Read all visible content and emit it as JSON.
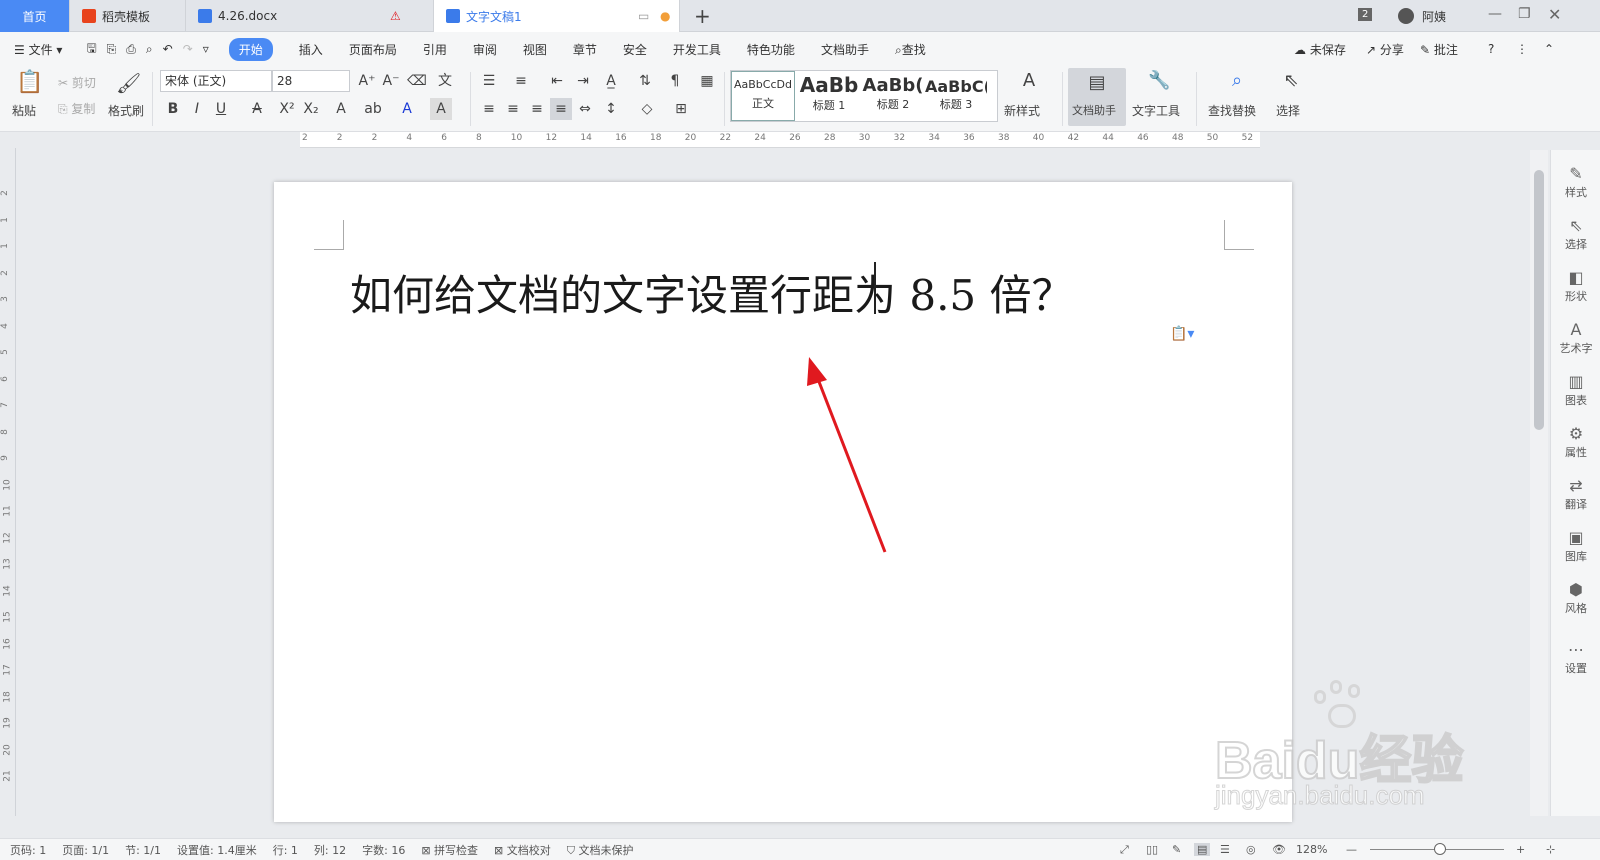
{
  "tabs": [
    {
      "label": "首页"
    },
    {
      "label": "稻壳模板"
    },
    {
      "label": "4.26.docx"
    },
    {
      "label": "文字文稿1"
    }
  ],
  "window": {
    "badge": "2",
    "user": "阿姨"
  },
  "menu": {
    "file": "文件",
    "items": [
      "开始",
      "插入",
      "页面布局",
      "引用",
      "审阅",
      "视图",
      "章节",
      "安全",
      "开发工具",
      "特色功能",
      "文档助手"
    ],
    "search": "查找",
    "right": [
      "未保存",
      "分享",
      "批注"
    ]
  },
  "ribbon": {
    "paste": "粘贴",
    "cut": "剪切",
    "copy": "复制",
    "format_painter": "格式刷",
    "font": "宋体 (正文)",
    "size": "28",
    "styles": [
      {
        "preview": "AaBbCcDd",
        "label": "正文"
      },
      {
        "preview": "AaBb",
        "label": "标题 1"
      },
      {
        "preview": "AaBb(",
        "label": "标题 2"
      },
      {
        "preview": "AaBbC(",
        "label": "标题 3"
      }
    ],
    "new_style": "新样式",
    "doc_assistant": "文档助手",
    "text_tools": "文字工具",
    "find_replace": "查找替换",
    "select": "选择"
  },
  "ruler": [
    "2",
    "2",
    "2",
    "4",
    "6",
    "8",
    "10",
    "12",
    "14",
    "16",
    "18",
    "20",
    "22",
    "24",
    "26",
    "28",
    "30",
    "32",
    "34",
    "36",
    "38",
    "40",
    "42",
    "44",
    "46",
    "48",
    "50",
    "52"
  ],
  "vruler": [
    "2",
    "1",
    "1",
    "2",
    "3",
    "4",
    "5",
    "6",
    "7",
    "8",
    "9",
    "10",
    "11",
    "12",
    "13",
    "14",
    "15",
    "16",
    "17",
    "18",
    "19",
    "20",
    "21"
  ],
  "document": {
    "text": "如何给文档的文字设置行距为 8.5 倍？"
  },
  "right_panel": [
    "样式",
    "选择",
    "形状",
    "艺术字",
    "图表",
    "属性",
    "翻译",
    "图库",
    "风格",
    "设置"
  ],
  "status": {
    "page": "页码: 1",
    "pages": "页面: 1/1",
    "section": "节: 1/1",
    "setting": "设置值: 1.4厘米",
    "row": "行: 1",
    "col": "列: 12",
    "words": "字数: 16",
    "spell": "拼写检查",
    "proof": "文档校对",
    "protect": "文档未保护",
    "zoom": "128%"
  },
  "watermark": {
    "brand": "Baidu经验",
    "url": "jingyan.baidu.com"
  },
  "colors": {
    "accent": "#4a8af4",
    "arrow": "#e0191f"
  }
}
